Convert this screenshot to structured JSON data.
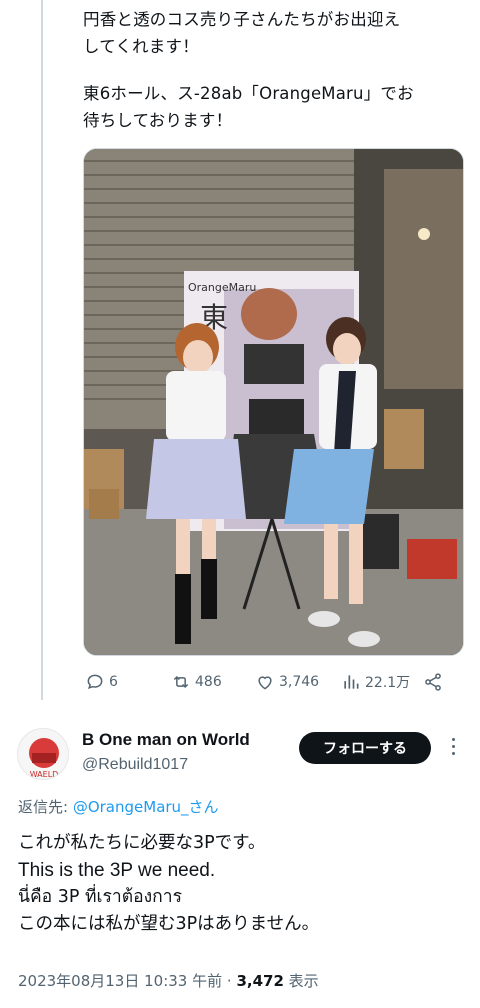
{
  "tweet1": {
    "text_line1": "円香と透のコス売り子さんたちがお出迎え",
    "text_line2": "してくれます！",
    "text_line3": "東6ホール、ス-28ab「OrangeMaru」でお",
    "text_line4": "待ちしております！",
    "photo": {
      "banner_brand": "OrangeMaru",
      "banner_kanji": "東"
    },
    "actions": {
      "replies": "6",
      "retweets": "486",
      "likes": "3,746",
      "views": "22.1万"
    }
  },
  "tweet2": {
    "display_name": "B One man on World",
    "handle": "@Rebuild1017",
    "avatar_text": "WAELD",
    "follow_label": "フォローする",
    "reply_prefix": "返信先: ",
    "reply_handle": "@OrangeMaru_さん",
    "lines": [
      "これが私たちに必要な3Pです。",
      "This is the 3P we need.",
      "นี่คือ 3P ที่เราต้องการ",
      "この本には私が望む3Pはありません。"
    ],
    "timestamp": "2023年08月13日 10:33 午前",
    "separator": " · ",
    "views_count": "3,472",
    "views_label": " 表示"
  }
}
